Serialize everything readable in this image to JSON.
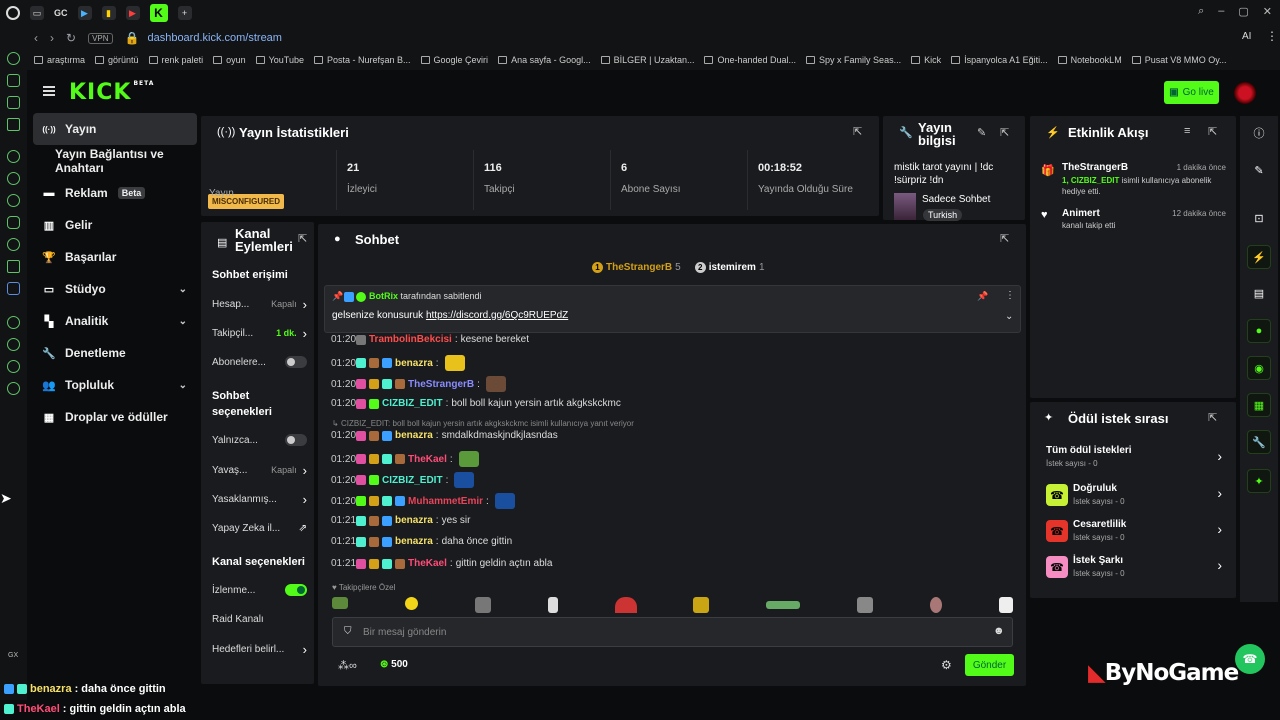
{
  "browser": {
    "tab_gc": "GC",
    "url": "dashboard.kick.com/stream",
    "vpn": "VPN",
    "ai": "AI",
    "bookmarks": [
      "araştırma",
      "görüntü",
      "renk paleti",
      "oyun",
      "YouTube",
      "Posta - Nurefşan B...",
      "Google Çeviri",
      "Ana sayfa - Googl...",
      "BİLGER | Uzaktan...",
      "One-handed Dual...",
      "Spy x Family Seas...",
      "Kick",
      "İspanyolca A1 Eğiti...",
      "NotebookLM",
      "Pusat V8 MMO Oy..."
    ],
    "gx_label": "GX"
  },
  "header": {
    "logo": "KICK",
    "logo_beta": "BETA",
    "go_live": "Go live"
  },
  "nav": {
    "items": [
      {
        "label": "Yayın",
        "icon": "broadcast-icon"
      },
      {
        "label": "Yayın Bağlantısı ve Anahtarı",
        "icon": ""
      },
      {
        "label": "Reklam",
        "icon": "ad-icon",
        "badge": "Beta"
      },
      {
        "label": "Gelir",
        "icon": "chart-icon"
      },
      {
        "label": "Başarılar",
        "icon": "trophy-icon"
      },
      {
        "label": "Stüdyo",
        "icon": "studio-icon"
      },
      {
        "label": "Analitik",
        "icon": "analytics-icon"
      },
      {
        "label": "Denetleme",
        "icon": "wrench-icon"
      },
      {
        "label": "Topluluk",
        "icon": "community-icon"
      },
      {
        "label": "Droplar ve ödüller",
        "icon": "drops-icon"
      }
    ]
  },
  "stats": {
    "title": "Yayın İstatistikleri",
    "status_badge": "MISCONFIGURED",
    "status_label": "Yayın",
    "viewers_value": "21",
    "viewers_label": "İzleyici",
    "followers_value": "116",
    "followers_label": "Takipçi",
    "subs_value": "6",
    "subs_label": "Abone Sayısı",
    "uptime_value": "00:18:52",
    "uptime_label": "Yayında Olduğu Süre"
  },
  "info": {
    "title_line1": "Yayın",
    "title_line2": "bilgisi",
    "stream_title": "mistik tarot yayını | !dc !sürpriz !dn",
    "category": "Sadece Sohbet",
    "language": "Turkish"
  },
  "feed": {
    "title": "Etkinlik Akışı",
    "events": [
      {
        "user": "TheStrangerB",
        "time": "1 dakika önce",
        "highlight": "1, CIZBIZ_EDIT",
        "text": " isimli kullanıcıya abonelik hediye etti."
      },
      {
        "user": "Animert",
        "time": "12 dakika önce",
        "highlight": "",
        "text": "kanalı takip etti"
      }
    ]
  },
  "queue": {
    "title": "Ödül istek sırası",
    "all_label": "Tüm ödül istekleri",
    "all_count": "İstek sayısı - 0",
    "items": [
      {
        "label": "Doğruluk",
        "count": "İstek sayısı - 0",
        "color": "#c6f135"
      },
      {
        "label": "Cesaretlilik",
        "count": "İstek sayısı - 0",
        "color": "#e5352b"
      },
      {
        "label": "İstek Şarkı",
        "count": "İstek sayısı - 0",
        "color": "#f58cc2"
      }
    ]
  },
  "actions": {
    "title_line1": "Kanal",
    "title_line2": "Eylemleri",
    "access_header": "Sohbet erişimi",
    "rows1": [
      {
        "label": "Hesap...",
        "value": "Kapalı"
      },
      {
        "label": "Takipçil...",
        "value": "1 dk."
      },
      {
        "label": "Abonelere...",
        "value": ""
      }
    ],
    "options_header_1": "Sohbet",
    "options_header_2": "seçenekleri",
    "rows2": [
      {
        "label": "Yalnızca...",
        "value": ""
      },
      {
        "label": "Yavaş...",
        "value": "Kapalı"
      },
      {
        "label": "Yasaklanmış...",
        "value": ""
      },
      {
        "label": "Yapay Zeka il...",
        "value": ""
      }
    ],
    "channel_header": "Kanal seçenekleri",
    "rows3": [
      {
        "label": "İzlenme...",
        "value": ""
      },
      {
        "label": "Raid Kanalı",
        "value": ""
      },
      {
        "label": "Hedefleri belirl...",
        "value": ""
      }
    ]
  },
  "chat": {
    "title": "Sohbet",
    "top_users": [
      {
        "rank": "1",
        "name": "TheStrangerB",
        "count": "5"
      },
      {
        "rank": "2",
        "name": "istemirem",
        "count": "1"
      }
    ],
    "pinned_by": "BotRix",
    "pinned_suffix": " tarafından sabitlendi",
    "pinned_text": "gelsenize konusuruk ",
    "pinned_link": "https://discord.gg/6Qc9RUEPdZ",
    "messages": [
      {
        "time": "01:20",
        "user": "TrambolinBekcisi",
        "color": "#ff4d4d",
        "text": "kesene bereket"
      },
      {
        "time": "01:20",
        "user": "benazra",
        "color": "#f5e16a",
        "text": ""
      },
      {
        "time": "01:20",
        "user": "TheStrangerB",
        "color": "#8a8cff",
        "text": ""
      },
      {
        "time": "01:20",
        "user": "CIZBIZ_EDIT",
        "color": "#4ff0d0",
        "text": "boll boll kajun yersin artık akgkskckmc"
      },
      {
        "time": "01:20",
        "user": "benazra",
        "color": "#f5e16a",
        "text": "smdalkdmaskjndkjlasndas"
      },
      {
        "time": "01:20",
        "user": "TheKael",
        "color": "#ff4d77",
        "text": ""
      },
      {
        "time": "01:20",
        "user": "CIZBIZ_EDIT",
        "color": "#4ff0d0",
        "text": ""
      },
      {
        "time": "01:20",
        "user": "MuhammetEmir",
        "color": "#e8445a",
        "text": ""
      },
      {
        "time": "01:21",
        "user": "benazra",
        "color": "#f5e16a",
        "text": "yes sir"
      },
      {
        "time": "01:21",
        "user": "benazra",
        "color": "#f5e16a",
        "text": "daha önce gittin"
      },
      {
        "time": "01:21",
        "user": "TheKael",
        "color": "#ff4d77",
        "text": "gittin geldin açtın abla"
      }
    ],
    "reply_note": "CIZBIZ_EDIT: boll boll kajun yersin artık akgkskckmc isimli kullanıcıya yanıt veriyor",
    "followers_only": "Takipçilere Özel",
    "input_placeholder": "Bir mesaj gönderin",
    "points": "500",
    "send_label": "Gönder"
  },
  "overlay": {
    "line1_user": "benazra",
    "line1_text": " : daha önce gittin",
    "line2_user": "TheKael",
    "line2_text": " : gittin geldin açtın abla",
    "brand": "ByNoGame"
  },
  "colors": {
    "accent": "#53fc18",
    "panel": "#191b1e",
    "background": "#0b0c0d"
  }
}
